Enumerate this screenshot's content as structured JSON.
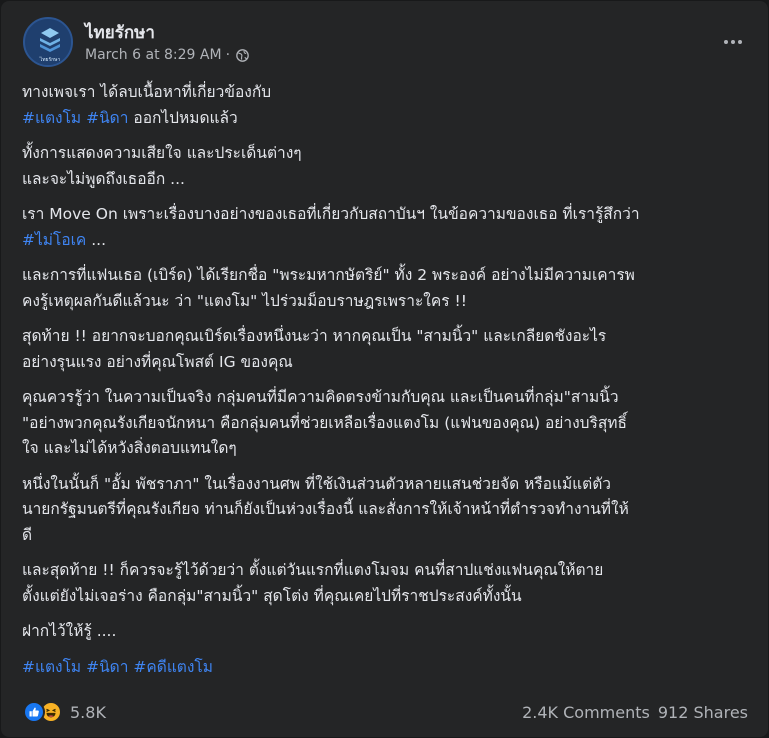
{
  "post": {
    "page_name": "ไทยรักษา",
    "timestamp": "March 6 at 8:29 AM",
    "separator": "·",
    "avatar_text": "ไทยรักษา",
    "paragraphs": [
      [
        [
          {
            "t": "ทางเพจเรา ได้ลบเนื้อหาที่เกี่ยวข้องกับ"
          }
        ],
        [
          {
            "t": "#แตงโม",
            "tag": true
          },
          {
            "t": " "
          },
          {
            "t": "#นิดา",
            "tag": true
          },
          {
            "t": " ออกไปหมดแล้ว"
          }
        ]
      ],
      [
        [
          {
            "t": "ทั้งการแสดงความเสียใจ และประเด็นต่างๆ"
          }
        ],
        [
          {
            "t": "และจะไม่พูดถึงเธออีก ..."
          }
        ]
      ],
      [
        [
          {
            "t": "เรา Move On เพราะเรื่องบางอย่างของเธอที่เกี่ยวกับสถาบันฯ ในข้อความของเธอ ที่เรารู้สึกว่า"
          }
        ],
        [
          {
            "t": "#ไม่โอเค",
            "tag": true
          },
          {
            "t": " ..."
          }
        ]
      ],
      [
        [
          {
            "t": "และการที่แฟนเธอ (เบิร์ด) ได้เรียกชื่อ \"พระมหากษัตริย์\" ทั้ง 2 พระองค์ อย่างไม่มีความเคารพ"
          }
        ],
        [
          {
            "t": "คงรู้เหตุผลกันดีแล้วนะ ว่า \"แตงโม\" ไปร่วมม็อบราษฎรเพราะใคร !!"
          }
        ]
      ],
      [
        [
          {
            "t": "สุดท้าย !! อยากจะบอกคุณเบิร์ดเรื่องหนึ่งนะว่า  หากคุณเป็น \"สามนิ้ว\" และเกลียดชังอะไร"
          }
        ],
        [
          {
            "t": "อย่างรุนแรง อย่างที่คุณโพสต์ IG ของคุณ"
          }
        ]
      ],
      [
        [
          {
            "t": "คุณควรรู้ว่า ในความเป็นจริง กลุ่มคนที่มีความคิดตรงข้ามกับคุณ และเป็นคนที่กลุ่ม\"สามนิ้ว"
          }
        ],
        [
          {
            "t": "\"อย่างพวกคุณรังเกียจนักหนา คือกลุ่มคนที่ช่วยเหลือเรื่องแตงโม (แฟนของคุณ) อย่างบริสุทธิ์"
          }
        ],
        [
          {
            "t": "ใจ และไม่ได้หวังสิ่งตอบแทนใดๆ"
          }
        ]
      ],
      [
        [
          {
            "t": "หนึ่งในนั้นก็ \"อั้ม พัชราภา\" ในเรื่องงานศพ ที่ใช้เงินส่วนตัวหลายแสนช่วยจัด หรือแม้แต่ตัว"
          }
        ],
        [
          {
            "t": "นายกรัฐมนตรีที่คุณรังเกียจ ท่านก็ยังเป็นห่วงเรื่องนี้ และสั่งการให้เจ้าหน้าที่ตำรวจทำงานที่ให้"
          }
        ],
        [
          {
            "t": "ดี"
          }
        ]
      ],
      [
        [
          {
            "t": "และสุดท้าย !! ก็ควรจะรู้ไว้ด้วยว่า ตั้งแต่วันแรกที่แตงโมจม คนที่สาปแช่งแฟนคุณให้ตาย"
          }
        ],
        [
          {
            "t": "ตั้งแต่ยังไม่เจอร่าง คือกลุ่ม\"สามนิ้ว\" สุดโต่ง ที่คุณเคยไปที่ราชประสงค์ทั้งนั้น"
          }
        ]
      ],
      [
        [
          {
            "t": "ฝากไว้ให้รู้ ...."
          }
        ]
      ],
      [
        [
          {
            "t": "#แตงโม",
            "tag": true
          },
          {
            "t": " "
          },
          {
            "t": "#นิดา",
            "tag": true
          },
          {
            "t": " "
          },
          {
            "t": "#คดีแตงโม",
            "tag": true
          }
        ]
      ]
    ],
    "reaction_icons": [
      "like-icon",
      "haha-icon"
    ],
    "reaction_count": "5.8K",
    "comments": "2.4K Comments",
    "shares": "912 Shares",
    "colors": {
      "background": "#18191a",
      "card": "#242526",
      "text": "#e4e6eb",
      "secondary": "#b0b3b8",
      "hashtag": "#3f85f3",
      "like": "#1877f2",
      "haha": "#f7b125"
    }
  }
}
